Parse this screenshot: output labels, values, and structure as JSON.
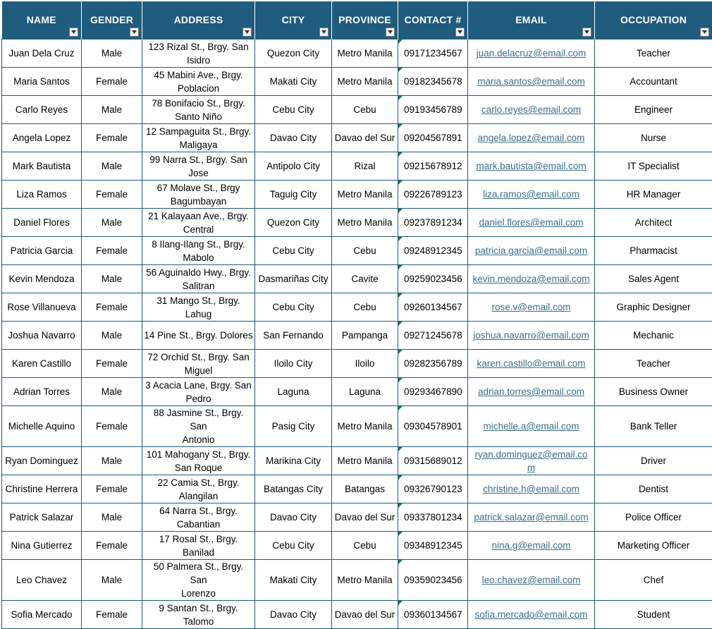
{
  "headers": [
    "NAME",
    "GENDER",
    "ADDRESS",
    "CITY",
    "PROVINCE",
    "CONTACT #",
    "EMAIL",
    "OCCUPATION"
  ],
  "header_icon": "filter-dropdown-icon",
  "colors": {
    "header_bg": "#1f5c7e",
    "header_text": "#ffffff",
    "grid": "#1f5c7e",
    "link": "#3a6e8a",
    "error_marker": "#1e7c3a"
  },
  "rows": [
    {
      "name": "Juan Dela Cruz",
      "gender": "Male",
      "address": [
        "123 Rizal St., Brgy. San",
        "Isidro"
      ],
      "city": "Quezon City",
      "province": "Metro Manila",
      "contact": "09171234567",
      "email": "juan.delacruz@email.com",
      "occupation": "Teacher"
    },
    {
      "name": "Maria Santos",
      "gender": "Female",
      "address": [
        "45 Mabini Ave., Brgy.",
        "Poblacion"
      ],
      "city": "Makati City",
      "province": "Metro Manila",
      "contact": "09182345678",
      "email": "maria.santos@email.com",
      "occupation": "Accountant"
    },
    {
      "name": "Carlo Reyes",
      "gender": "Male",
      "address": [
        "78 Bonifacio St., Brgy.",
        "Santo Niño"
      ],
      "city": "Cebu City",
      "province": "Cebu",
      "contact": "09193456789",
      "email": "carlo.reyes@email.com",
      "occupation": "Engineer"
    },
    {
      "name": "Angela Lopez",
      "gender": "Female",
      "address": [
        "12 Sampaguita St., Brgy.",
        "Maligaya"
      ],
      "city": "Davao City",
      "province": "Davao del Sur",
      "contact": "09204567891",
      "email": "angela.lopez@email.com",
      "occupation": "Nurse"
    },
    {
      "name": "Mark Bautista",
      "gender": "Male",
      "address": [
        "99 Narra St., Brgy. San",
        "Jose"
      ],
      "city": "Antipolo City",
      "province": "Rizal",
      "contact": "09215678912",
      "email": "mark.bautista@email.com",
      "occupation": "IT Specialist"
    },
    {
      "name": "Liza Ramos",
      "gender": "Female",
      "address": [
        "67 Molave St., Brgy",
        "Bagumbayan"
      ],
      "city": "Taguig City",
      "province": "Metro Manila",
      "contact": "09226789123",
      "email": "liza.ramos@email.com",
      "occupation": "HR Manager"
    },
    {
      "name": "Daniel Flores",
      "gender": "Male",
      "address": [
        "21 Kalayaan Ave., Brgy.",
        "Central"
      ],
      "city": "Quezon City",
      "province": "Metro Manila",
      "contact": "09237891234",
      "email": "daniel.flores@email.com",
      "occupation": "Architect"
    },
    {
      "name": "Patricia Garcia",
      "gender": "Female",
      "address": [
        "8 Ilang-Ilang St., Brgy.",
        "Mabolo"
      ],
      "city": "Cebu City",
      "province": "Cebu",
      "contact": "09248912345",
      "email": "patricia.garcia@email.com",
      "occupation": "Pharmacist"
    },
    {
      "name": "Kevin Mendoza",
      "gender": "Male",
      "address": [
        "56 Aguinaldo Hwy., Brgy.",
        "Salitran"
      ],
      "city": "Dasmariñas City",
      "province": "Cavite",
      "contact": "09259023456",
      "email": "kevin.mendoza@email.com",
      "occupation": "Sales Agent"
    },
    {
      "name": "Rose Villanueva",
      "gender": "Female",
      "address": [
        "31 Mango St., Brgy. Lahug"
      ],
      "city": "Cebu City",
      "province": "Cebu",
      "contact": "09260134567",
      "email": "rose.v@email.com",
      "occupation": "Graphic Designer"
    },
    {
      "name": "Joshua Navarro",
      "gender": "Male",
      "address": [
        "14 Pine St., Brgy. Dolores"
      ],
      "city": "San Fernando",
      "province": "Pampanga",
      "contact": "09271245678",
      "email": "joshua.navarro@email.com",
      "occupation": "Mechanic"
    },
    {
      "name": "Karen Castillo",
      "gender": "Female",
      "address": [
        "72 Orchid St., Brgy. San",
        "Miguel"
      ],
      "city": "Iloilo City",
      "province": "Iloilo",
      "contact": "09282356789",
      "email": "karen.castillo@email.com",
      "occupation": "Teacher"
    },
    {
      "name": "Adrian Torres",
      "gender": "Male",
      "address": [
        "3 Acacia Lane, Brgy. San",
        "Pedro"
      ],
      "city": "Laguna",
      "province": "Laguna",
      "contact": "09293467890",
      "email": "adrian.torres@email.com",
      "occupation": "Business Owner"
    },
    {
      "name": "Michelle Aquino",
      "gender": "Female",
      "address": [
        "88 Jasmine St., Brgy. San",
        "Antonio"
      ],
      "city": "Pasig City",
      "province": "Metro Manila",
      "contact": "09304578901",
      "email": "michelle.a@email.com",
      "occupation": "Bank Teller"
    },
    {
      "name": "Ryan Dominguez",
      "gender": "Male",
      "address": [
        "101 Mahogany St., Brgy.",
        "San Roque"
      ],
      "city": "Marikina City",
      "province": "Metro Manila",
      "contact": "09315689012",
      "email": [
        "ryan.dominguez@email.co",
        "m"
      ],
      "occupation": "Driver"
    },
    {
      "name": "Christine Herrera",
      "gender": "Female",
      "address": [
        "22 Camia St., Brgy.",
        "Alangilan"
      ],
      "city": "Batangas City",
      "province": "Batangas",
      "contact": "09326790123",
      "email": "christine.h@email.com",
      "occupation": "Dentist"
    },
    {
      "name": "Patrick Salazar",
      "gender": "Male",
      "address": [
        "64 Narra St., Brgy.",
        "Cabantian"
      ],
      "city": "Davao City",
      "province": "Davao del Sur",
      "contact": "09337801234",
      "email": "patrick.salazar@email.com",
      "occupation": "Police Officer"
    },
    {
      "name": "Nina Gutierrez",
      "gender": "Female",
      "address": [
        "17 Rosal St., Brgy.",
        "Banilad"
      ],
      "city": "Cebu City",
      "province": "Cebu",
      "contact": "09348912345",
      "email": "nina.g@email.com",
      "occupation": "Marketing Officer"
    },
    {
      "name": "Leo Chavez",
      "gender": "Male",
      "address": [
        "50 Palmera St., Brgy. San",
        "Lorenzo"
      ],
      "city": "Makati City",
      "province": "Metro Manila",
      "contact": "09359023456",
      "email": "leo.chavez@email.com",
      "occupation": "Chef"
    },
    {
      "name": "Sofia Mercado",
      "gender": "Female",
      "address": [
        "9 Santan St., Brgy.",
        "Talomo"
      ],
      "city": "Davao City",
      "province": "Davao del Sur",
      "contact": "09360134567",
      "email": "sofia.mercado@email.com",
      "occupation": "Student"
    }
  ]
}
